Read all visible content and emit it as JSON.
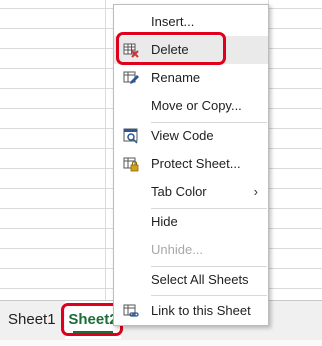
{
  "context_menu": {
    "items": [
      {
        "label": "Insert...",
        "icon": "",
        "enabled": true
      },
      {
        "label": "Delete",
        "icon": "delete-sheet-icon",
        "enabled": true
      },
      {
        "label": "Rename",
        "icon": "rename-icon",
        "enabled": true
      },
      {
        "label": "Move or Copy...",
        "icon": "",
        "enabled": true
      },
      {
        "label": "View Code",
        "icon": "view-code-icon",
        "enabled": true
      },
      {
        "label": "Protect Sheet...",
        "icon": "protect-sheet-icon",
        "enabled": true
      },
      {
        "label": "Tab Color",
        "icon": "",
        "enabled": true,
        "submenu_indicator": "›"
      },
      {
        "label": "Hide",
        "icon": "",
        "enabled": true
      },
      {
        "label": "Unhide...",
        "icon": "",
        "enabled": false
      },
      {
        "label": "Select All Sheets",
        "icon": "",
        "enabled": true
      },
      {
        "label": "Link to this Sheet",
        "icon": "link-icon",
        "enabled": true
      }
    ]
  },
  "sheet_tabs": [
    {
      "label": "Sheet1",
      "active": false
    },
    {
      "label": "Sheet2",
      "active": true
    }
  ],
  "colors": {
    "highlight": "#e0001b",
    "active_tab_text": "#1d6d3b",
    "icon_green": "#217346",
    "icon_blue": "#2b5797"
  }
}
